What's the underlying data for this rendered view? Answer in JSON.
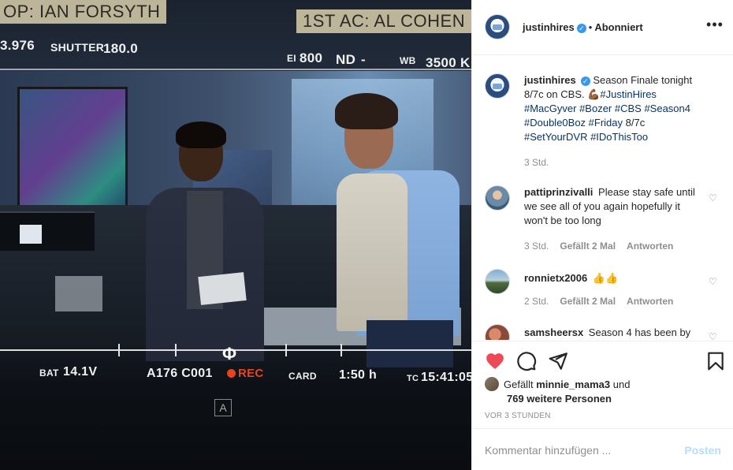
{
  "photo": {
    "slate_left": "OP: IAN FORSYTH",
    "slate_right": "1ST AC: AL COHEN",
    "hud_top": {
      "fstop": "3.976",
      "shutter_label": "SHUTTER",
      "shutter_value": "180.0",
      "ei_label": "EI",
      "ei_value": "800",
      "nd_label": "ND",
      "nd_value": "-",
      "wb_label": "WB",
      "wb_value": "3500 K"
    },
    "hud_bottom": {
      "bat_label": "BAT",
      "bat_value": "14.1V",
      "clip": "A176 C001",
      "rec": "REC",
      "card_label": "CARD",
      "card_value": "1:50 h",
      "tc_label": "TC",
      "tc_value": "15:41:05"
    },
    "phi_glyph": "Φ",
    "letter_a": "A"
  },
  "header": {
    "username": "justinhires",
    "separator": "•",
    "follow_status": "Abonniert",
    "more_glyph": "•••"
  },
  "caption": {
    "username": "justinhires",
    "text_plain": "Season Finale tonight 8/7c on CBS. ",
    "emoji": "💪🏾",
    "hashtags_1": "#JustinHires",
    "hashtags_2": "#MacGyver #Bozer #CBS #Season4",
    "hashtags_3": "#Double0Boz #Friday",
    "text_after_friday": " 8/7c",
    "hashtags_4": "#SetYourDVR #IDoThisToo",
    "time": "3 Std."
  },
  "comments": [
    {
      "username": "pattiprinzivalli",
      "text": "Please stay safe until we see all of you again hopefully it won't be too long",
      "time": "3 Std.",
      "likes": "Gefällt 2 Mal",
      "reply": "Antworten"
    },
    {
      "username": "ronnietx2006",
      "text": "👍👍",
      "time": "2 Std.",
      "likes": "Gefällt 2 Mal",
      "reply": "Antworten"
    },
    {
      "username": "samsheersx",
      "text": "Season 4 has been by"
    }
  ],
  "actions": {
    "liked_by_prefix": "Gefällt",
    "liked_by_user": "minnie_mama3",
    "liked_by_and": "und",
    "liked_by_others": "769 weitere Personen",
    "time_ago": "VOR 3 STUNDEN"
  },
  "add_comment": {
    "placeholder": "Kommentar hinzufügen ...",
    "post_label": "Posten"
  },
  "colors": {
    "like_red": "#ed4956",
    "link_blue": "#00376b",
    "verified_blue": "#3897f0",
    "muted_gray": "#8e8e8e",
    "post_disabled": "#b2dffc",
    "rec_red": "#e8431e"
  }
}
